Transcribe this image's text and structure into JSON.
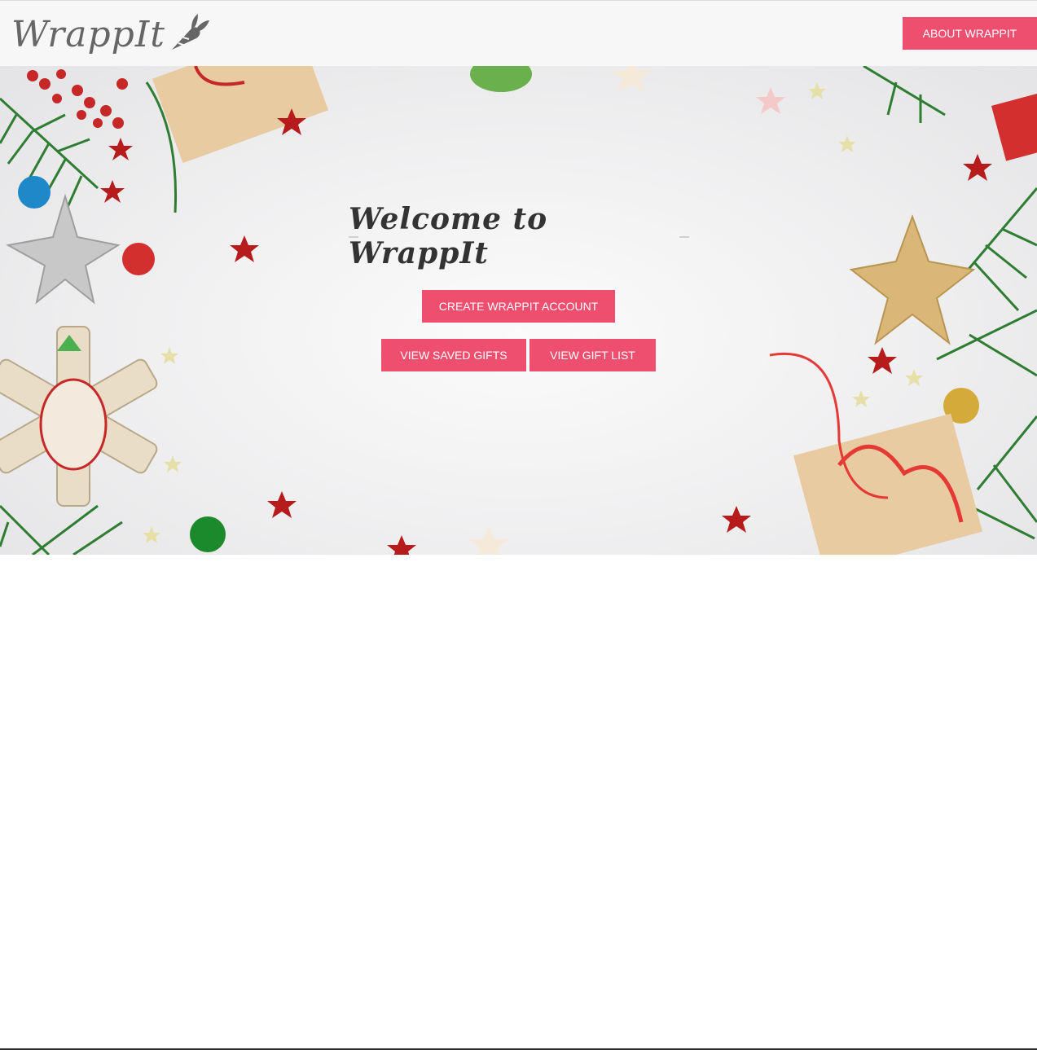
{
  "header": {
    "logo_text": "WrappIt",
    "about_button": "ABOUT WRAPPIT"
  },
  "hero": {
    "title": "Welcome to WrappIt",
    "create_account_button": "CREATE WRAPPIT ACCOUNT",
    "view_saved_gifts_button": "VIEW SAVED GIFTS",
    "view_gift_list_button": "VIEW GIFT LIST"
  },
  "colors": {
    "accent": "#ef4f6e",
    "header_bg": "#f7f7f7",
    "logo_text": "#666666",
    "title_text": "#333333"
  },
  "icons": {
    "logo_icon": "carrot-icon"
  }
}
